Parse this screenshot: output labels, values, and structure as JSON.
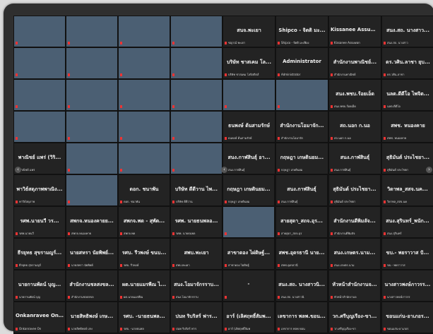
{
  "controls": {
    "prev_arrow": "‹",
    "next_arrow": "›"
  },
  "tiles": [
    {
      "name": "",
      "label": "",
      "video": true
    },
    {
      "name": "",
      "label": "",
      "video": true
    },
    {
      "name": "",
      "label": "",
      "video": true
    },
    {
      "name": "",
      "label": "",
      "video": true
    },
    {
      "name": "สนจ.พะเยา",
      "label": "ชญาณ์ พะเยา"
    },
    {
      "name": "Shipco - จิตติ มะ...",
      "label": "Shipco - จิตติ มะเฟือง"
    },
    {
      "name": "Kissanee Assuwan",
      "label": "Kissanee Assuwan"
    },
    {
      "name": "สนง.สถ. นางสาว...",
      "label": "สนง.สถ. นางสาว"
    },
    {
      "name": "",
      "label": "",
      "video": true
    },
    {
      "name": "",
      "label": "",
      "video": true
    },
    {
      "name": "",
      "label": "",
      "video": true
    },
    {
      "name": "",
      "label": "",
      "video": true
    },
    {
      "name": "บริษัท ชาสเคม โล...",
      "label": "บริษัท ชาสเคม โลจิสติกส์"
    },
    {
      "name": "Administrator",
      "label": "Administrator"
    },
    {
      "name": "สำนักงานพาณิชย์...",
      "label": "สำนักงานพาณิชย์"
    },
    {
      "name": "ดร.วศิน.ลาชา ยุบ...",
      "label": "ดร.วศิน.ลาชา"
    },
    {
      "name": "",
      "label": "",
      "video": true
    },
    {
      "name": "",
      "label": "",
      "video": true
    },
    {
      "name": "",
      "label": "",
      "video": true
    },
    {
      "name": "",
      "label": "",
      "video": true
    },
    {
      "name": "",
      "label": "",
      "video": true
    },
    {
      "name": "",
      "label": "",
      "video": true
    },
    {
      "name": "สนง.พชบ.ร้อยเอ็ด",
      "label": "สนง.พชบ.ร้อยเอ็ด"
    },
    {
      "name": "นลต.ดีดีโอ ไพจิต...",
      "label": "นลต.ดีดีโอ"
    },
    {
      "name": "",
      "label": "",
      "video": true
    },
    {
      "name": "",
      "label": "",
      "video": true
    },
    {
      "name": "",
      "label": "",
      "video": true
    },
    {
      "name": "",
      "label": "",
      "video": true
    },
    {
      "name": "ธนพงษ์ ต้นสามรักษ์",
      "label": "ธนพงษ์ ต้นสามรักษ์"
    },
    {
      "name": "สำนักงานโอมาจัก...",
      "label": "สำนักงานโอมาจัก"
    },
    {
      "name": "สถ.นอก ก.นอ",
      "label": "สถ.นอก ก.นอ"
    },
    {
      "name": "สพช. หนองคาย",
      "label": "สพช. หนองคาย"
    },
    {
      "name": "พาณิชย์ แพร่ (วิริ...",
      "label": "พาณิชย์ แพร่"
    },
    {
      "name": "",
      "label": "",
      "video": true
    },
    {
      "name": "",
      "label": "",
      "video": true
    },
    {
      "name": "",
      "label": "",
      "video": true
    },
    {
      "name": "สนง.กาฬสินธุ์ อา...",
      "label": "สนง.กาฬสินธุ์"
    },
    {
      "name": "กฤษฎา เกษตินยม...",
      "label": "กฤษฎา เกษตินยม"
    },
    {
      "name": "สนง.กาฬสินธุ์",
      "label": "สนง.กาฬสินธุ์"
    },
    {
      "name": "สุธิมันต์ ประไชยา...",
      "label": "สุธิมันต์ ประไชยา"
    },
    {
      "name": "พาวิธ์สดุภาพพาณิง...",
      "label": "พาวิธ์สดุภาพ"
    },
    {
      "name": "",
      "label": "",
      "video": true
    },
    {
      "name": "ดอก. ชนาพัน",
      "label": "ดอก. ชนาพัน"
    },
    {
      "name": "บริษัท ดีดีวาน ไพ...",
      "label": "บริษัท ดีดีวาน"
    },
    {
      "name": "กฤษฎา เกษตินยม...",
      "label": "กฤษฎา เกษตินยม"
    },
    {
      "name": "สนง.กาฬสินธุ์",
      "label": "สนง.กาฬสินธุ์"
    },
    {
      "name": "สุธิมันต์ ประไชยา...",
      "label": "สุธิมันต์ ประไชยา"
    },
    {
      "name": "วิดาพล_สสจ.นค...",
      "label": "วิดาพล_สสจ.นค"
    },
    {
      "name": "รศพ.นายนวี วร...",
      "label": "รศพ.นายนวี"
    },
    {
      "name": "สพกจ.หนองคายย...",
      "label": "สพกจ.หนองคาย"
    },
    {
      "name": "สพกจ.พด - สุพัต...",
      "label": "สพกจ.พด"
    },
    {
      "name": "รศพ. นายธนพลอ...",
      "label": "รศพ. นายธนพล"
    },
    {
      "name": "",
      "label": "",
      "video": true
    },
    {
      "name": "สายสุดา_สถจ.อุร...",
      "label": "สายสุดา_สถจ.อุร"
    },
    {
      "name": "สำนักงานดีพิมลัจ...",
      "label": "สำนักงานดีพิมลัจ"
    },
    {
      "name": "สนง.สุรินทร์_พนัก...",
      "label": "สนง.สุรินทร์"
    },
    {
      "name": "ธีรยุทธ สุขรามญร์...",
      "label": "ธีรยุทธ สุขรามญร์"
    },
    {
      "name": "นายสหรา นัยพิพย์...",
      "label": "นายสหรา นัยพิพย์"
    },
    {
      "name": "รศบ. รีวพงษ์ ขนบ...",
      "label": "รศบ. รีวพงษ์"
    },
    {
      "name": "สพบ.พะเยา",
      "label": "สพบ.พะเยา"
    },
    {
      "name": "สาขาดอง ไผ่ดิษฐ์...",
      "label": "สาขาดอง ไผ่ดิษฐ์"
    },
    {
      "name": "สพช.อุดรธานี นาย...",
      "label": "สพช.อุดรธานี"
    },
    {
      "name": "สนง.เกษตร.นาม...",
      "label": "สนง.เกษตร.นาม"
    },
    {
      "name": "ขบ.- พยราวาส ปั...",
      "label": "ขบ.- พยราวาส"
    },
    {
      "name": "นายกานพัดน์ บุญ...",
      "label": "นายกานพัดน์ บุญ"
    },
    {
      "name": "สำนักงานชลสงขล...",
      "label": "สำนักงานชลสงขล"
    },
    {
      "name": "ผต.นายแมรพีณ ไ...",
      "label": "ผต.นายแมรพีณ"
    },
    {
      "name": "สนง.โอมาจักรราบ...",
      "label": "สนง.โอมาจักรราบ"
    },
    {
      "name": "-",
      "label": ""
    },
    {
      "name": "สนง.สถ. นางสาวนิ...",
      "label": "สนง.สถ. นางสาวนิ"
    },
    {
      "name": "หัวหน้าสำนักงานจ...",
      "label": "หัวหน้าสำนักงานจ"
    },
    {
      "name": "นางสาวพงษ์ภาวรร...",
      "label": "นางสาวพงษ์ภาวรร"
    },
    {
      "name": "Onkanravee On...",
      "label": "Onkanravee On"
    },
    {
      "name": "นายสิทธิพงษ์ เกษ...",
      "label": "นายสิทธิพงษ์ เกษ"
    },
    {
      "name": "รศบ. -นายธนพล...",
      "label": "รศบ. -นายธนพล"
    },
    {
      "name": "ปนท ริบริสร์ ฟาร...",
      "label": "ปนท ริบริสร์ ฟาร"
    },
    {
      "name": "อาร์ (เลิศฤทธิ์สัมพ...",
      "label": "อาร์ (เลิศฤทธิ์สัมพ"
    },
    {
      "name": "เลขาการ พลพ.ขอน...",
      "label": "เลขาการ พลพ.ขอน"
    },
    {
      "name": "วก.ศรีบุญเรือง-ขา...",
      "label": "วก.ศรีบุญเรือง-ขา"
    },
    {
      "name": "ขอนแก่น-อาเภอร...",
      "label": "ขอนแก่น-อาเภอร"
    }
  ]
}
